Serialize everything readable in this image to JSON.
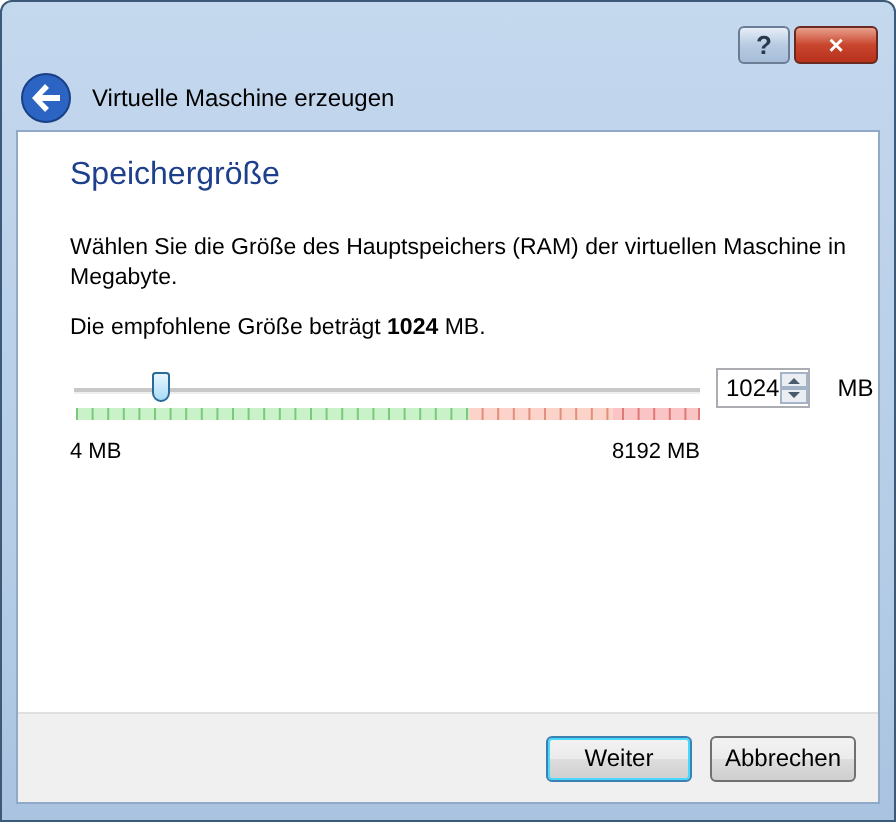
{
  "window": {
    "title": "Virtuelle Maschine erzeugen",
    "controls": [
      "?",
      "×"
    ]
  },
  "page": {
    "heading": "Speichergröße",
    "description": "Wählen Sie die Größe des Hauptspeichers (RAM) der virtuellen Maschine in Megabyte.",
    "recommendation": "Die empfohlene Größe beträgt **1024** MB."
  },
  "memory": {
    "level": 0.125,
    "value": "1024",
    "unit": "MB",
    "min_label": "4 MB",
    "max_label": "8192 MB"
  },
  "buttons": [
    {
      "label": "Weiter",
      "default": true
    },
    {
      "label": "Abbrechen",
      "default": false
    }
  ]
}
